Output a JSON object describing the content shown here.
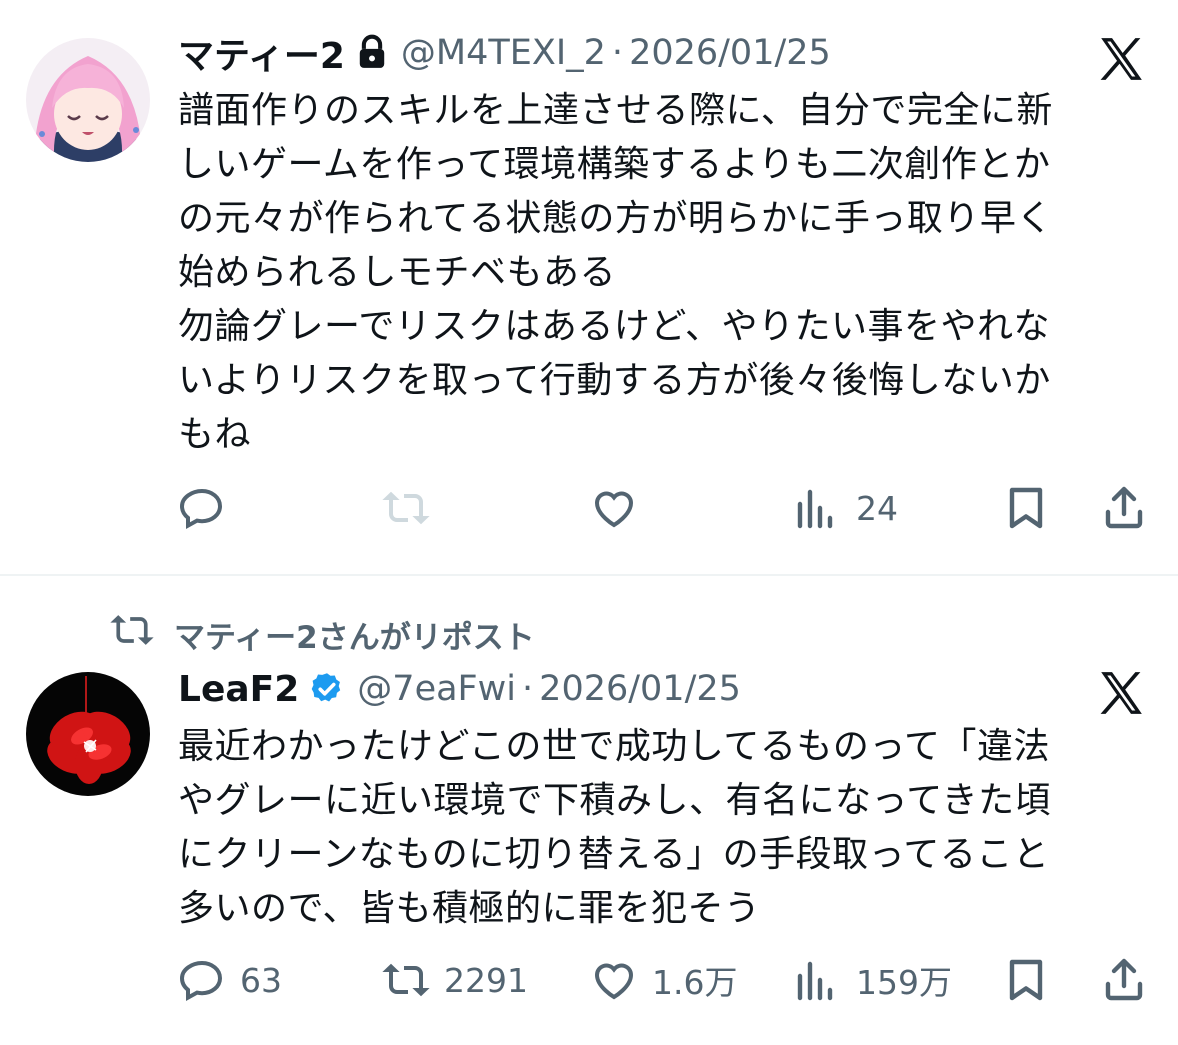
{
  "tweets": [
    {
      "user": {
        "display_name": "マティー2",
        "handle": "@M4TEXI_2",
        "protected": true
      },
      "meta_separator": "·",
      "date": "2026/01/25",
      "text": "譜面作りのスキルを上達させる際に、自分で完全に新\nしいゲームを作って環境構築するよりも二次創作とか\nの元々が作られてる状態の方が明らかに手っ取り早く\n始められるしモチベもある\n勿論グレーでリスクはあるけど、やりたい事をやれな\nいよりリスクを取って行動する方が後々後悔しないか\nもね",
      "actions": {
        "replies": "",
        "reposts": "",
        "likes": "",
        "views": "24"
      },
      "icons": [
        "reply-icon",
        "repost-icon",
        "like-icon",
        "views-icon",
        "bookmark-icon",
        "share-icon",
        "x-logo-icon",
        "lock-icon"
      ]
    },
    {
      "repost_banner": "マティー2さんがリポスト",
      "user": {
        "display_name": "LeaF2",
        "handle": "@7eaFwi",
        "verified": true
      },
      "meta_separator": "·",
      "date": "2026/01/25",
      "text": "最近わかったけどこの世で成功してるものって「違法\nやグレーに近い環境で下積みし、有名になってきた頃\nにクリーンなものに切り替える」の手段取ってること\n多いので、皆も積極的に罪を犯そう",
      "actions": {
        "replies": "63",
        "reposts": "2291",
        "likes": "1.6万",
        "views": "159万"
      },
      "icons": [
        "reply-icon",
        "repost-icon",
        "like-icon",
        "views-icon",
        "bookmark-icon",
        "share-icon",
        "x-logo-icon",
        "verified-badge-icon"
      ]
    }
  ],
  "colors": {
    "text_primary": "#0f1419",
    "text_secondary": "#536471",
    "verified_blue": "#1d9bf0",
    "divider": "#eff3f4",
    "repost_disabled": "#cfd9de"
  }
}
